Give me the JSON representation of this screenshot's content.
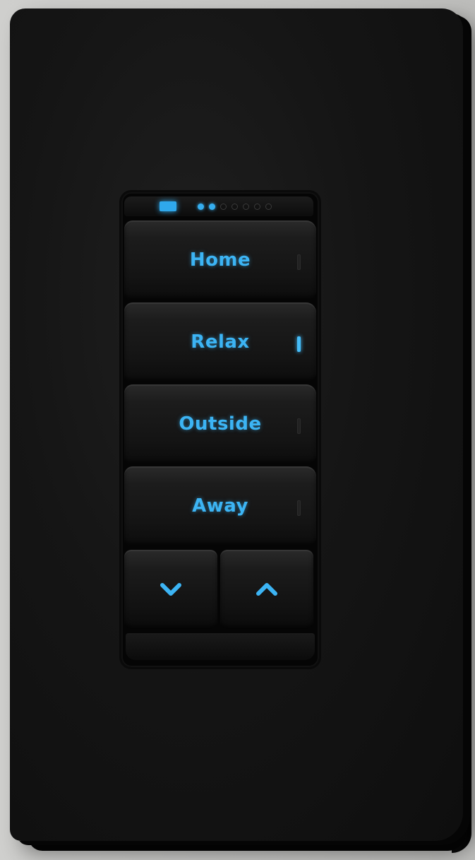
{
  "device": {
    "type": "wall keypad",
    "accent_color": "#3cb4f4",
    "body_color": "#141414"
  },
  "status": {
    "indicator_icon": "status-bar-led",
    "dots_total": 7,
    "dots_lit": 2
  },
  "buttons": [
    {
      "label": "Home",
      "indicator_on": false
    },
    {
      "label": "Relax",
      "indicator_on": true
    },
    {
      "label": "Outside",
      "indicator_on": false
    },
    {
      "label": "Away",
      "indicator_on": false
    }
  ],
  "arrows": {
    "down_icon": "chevron-down-icon",
    "up_icon": "chevron-up-icon"
  }
}
